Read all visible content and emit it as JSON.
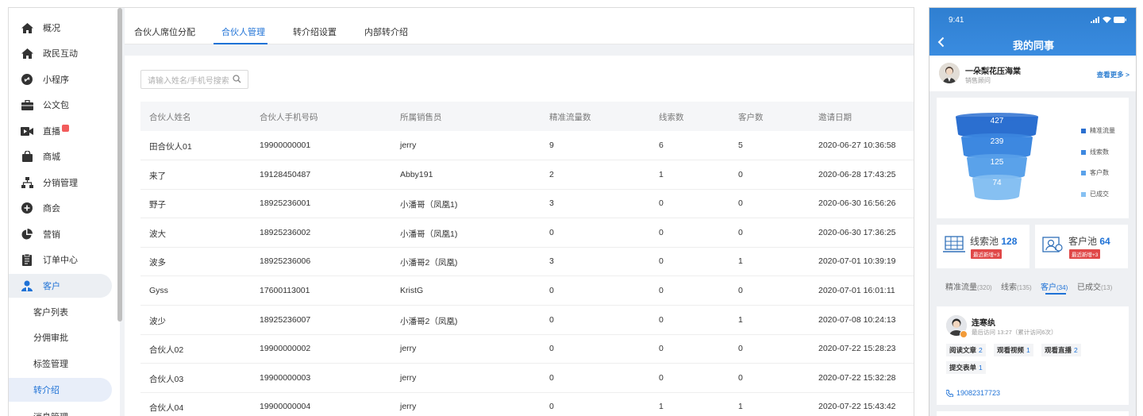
{
  "sidebar": {
    "items": [
      {
        "label": "概况",
        "icon": "home-icon"
      },
      {
        "label": "政民互动",
        "icon": "home-icon"
      },
      {
        "label": "小程序",
        "icon": "link-icon"
      },
      {
        "label": "公文包",
        "icon": "briefcase-icon"
      },
      {
        "label": "直播",
        "icon": "video-icon"
      },
      {
        "label": "商城",
        "icon": "shopping-bag-icon"
      },
      {
        "label": "分销管理",
        "icon": "org-chart-icon"
      },
      {
        "label": "商会",
        "icon": "plus-circle-icon"
      },
      {
        "label": "营销",
        "icon": "pie-chart-icon"
      },
      {
        "label": "订单中心",
        "icon": "document-icon"
      },
      {
        "label": "客户",
        "icon": "user-icon"
      }
    ],
    "sub_items": [
      "客户列表",
      "分佣审批",
      "标签管理",
      "转介绍",
      "消息管理"
    ]
  },
  "tabs": [
    "合伙人席位分配",
    "合伙人管理",
    "转介绍设置",
    "内部转介绍"
  ],
  "search": {
    "placeholder": "请输入姓名/手机号搜索"
  },
  "table": {
    "headers": [
      "合伙人姓名",
      "合伙人手机号码",
      "所属销售员",
      "精准流量数",
      "线索数",
      "客户数",
      "邀请日期"
    ],
    "rows": [
      [
        "田合伙人01",
        "19900000001",
        "jerry",
        "9",
        "6",
        "5",
        "2020-06-27 10:36:58"
      ],
      [
        "来了",
        "19128450487",
        "Abby191",
        "2",
        "1",
        "0",
        "2020-06-28 17:43:25"
      ],
      [
        "野子",
        "18925236001",
        "小潘哥（凤凰1)",
        "3",
        "0",
        "0",
        "2020-06-30 16:56:26"
      ],
      [
        "波大",
        "18925236002",
        "小潘哥（凤凰1)",
        "0",
        "0",
        "0",
        "2020-06-30 17:36:25"
      ],
      [
        "波多",
        "18925236006",
        "小潘哥2（凤凰)",
        "3",
        "0",
        "1",
        "2020-07-01 10:39:19"
      ],
      [
        "Gyss",
        "17600113001",
        "KristG",
        "0",
        "0",
        "0",
        "2020-07-01 16:01:11"
      ],
      [
        "波少",
        "18925236007",
        "小潘哥2（凤凰)",
        "0",
        "0",
        "1",
        "2020-07-08 10:24:13"
      ],
      [
        "合伙人02",
        "19900000002",
        "jerry",
        "0",
        "0",
        "0",
        "2020-07-22 15:28:23"
      ],
      [
        "合伙人03",
        "19900000003",
        "jerry",
        "0",
        "0",
        "0",
        "2020-07-22 15:32:28"
      ],
      [
        "合伙人04",
        "19900000004",
        "jerry",
        "0",
        "1",
        "1",
        "2020-07-22 15:43:42"
      ]
    ]
  },
  "phone": {
    "time": "9:41",
    "title": "我的同事",
    "user": {
      "name": "一朵梨花压海棠",
      "role": "销售顾问",
      "more": "查看更多 >"
    },
    "funnel": {
      "values": [
        "427",
        "239",
        "125",
        "74"
      ],
      "legend": [
        "精准流量",
        "线索数",
        "客户数",
        "已成交"
      ],
      "colors": [
        "#2b6fd0",
        "#3d88e0",
        "#5aa2ea",
        "#86c0f2"
      ]
    },
    "pools": [
      {
        "label": "线索池",
        "value": "128",
        "badge": "最近新增+3",
        "icon": "network-icon"
      },
      {
        "label": "客户池",
        "value": "64",
        "badge": "最近新增+3",
        "icon": "customer-icon"
      }
    ],
    "tabs": [
      {
        "label": "精准流量",
        "count": "(320)"
      },
      {
        "label": "线索",
        "count": "(135)"
      },
      {
        "label": "客户",
        "count": "(34)"
      },
      {
        "label": "已成交",
        "count": "(13)"
      }
    ],
    "customer": {
      "name": "连寒纨",
      "visit": "最后访问 13:27（累计访问6次）",
      "stats": [
        {
          "label": "阅读文章",
          "value": "2"
        },
        {
          "label": "观看视频",
          "value": "1"
        },
        {
          "label": "观看直播",
          "value": "2"
        },
        {
          "label": "提交表单",
          "value": "1"
        }
      ],
      "phone": "19082317723"
    }
  }
}
